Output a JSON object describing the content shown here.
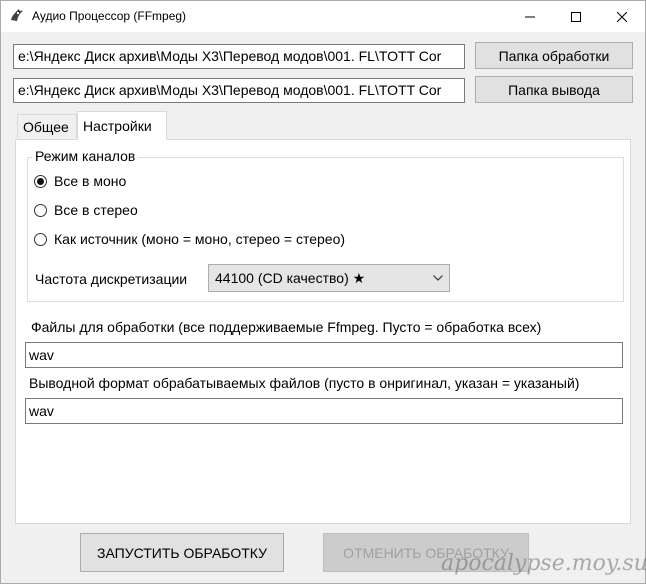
{
  "window": {
    "title": "Аудио Процессор (FFmpeg)",
    "icon": "app-icon",
    "controls": {
      "minimize": "minimize-icon",
      "maximize": "maximize-icon",
      "close": "close-icon"
    }
  },
  "paths": {
    "processing_path": "e:\\Яндекс Диск архив\\Моды X3\\Перевод модов\\001. FL\\TOTT Cor",
    "output_path": "e:\\Яндекс Диск архив\\Моды X3\\Перевод модов\\001. FL\\TOTT Cor",
    "processing_button": "Папка обработки",
    "output_button": "Папка вывода"
  },
  "tabs": [
    {
      "label": "Общее",
      "active": false
    },
    {
      "label": "Настройки",
      "active": true
    }
  ],
  "channels": {
    "legend": "Режим каналов",
    "options": [
      {
        "label": "Все в моно",
        "checked": true
      },
      {
        "label": "Все в стерео",
        "checked": false
      },
      {
        "label": "Как источник (моно = моно, стерео = стерео)",
        "checked": false
      }
    ]
  },
  "sample_rate": {
    "label": "Частота дискретизации",
    "selected": "44100 (CD качество) ★"
  },
  "files": {
    "label": "Файлы для обработки (все поддерживаемые Ffmpeg. Пусто = обработка всех)",
    "value": "wav"
  },
  "output_format": {
    "label": "Выводной формат обрабатываемых файлов (пусто в онригинал, указан = указаный)",
    "value": "wav"
  },
  "actions": {
    "start": "ЗАПУСТИТЬ ОБРАБОТКУ",
    "cancel": "ОТМЕНИТЬ ОБРАБОТКУ"
  },
  "watermark": "apocalypse.moy.su",
  "colors": {
    "disabled_text": "#a0a0a0",
    "button_bg": "#e1e1e1",
    "window_bg": "#f0f0f0"
  }
}
